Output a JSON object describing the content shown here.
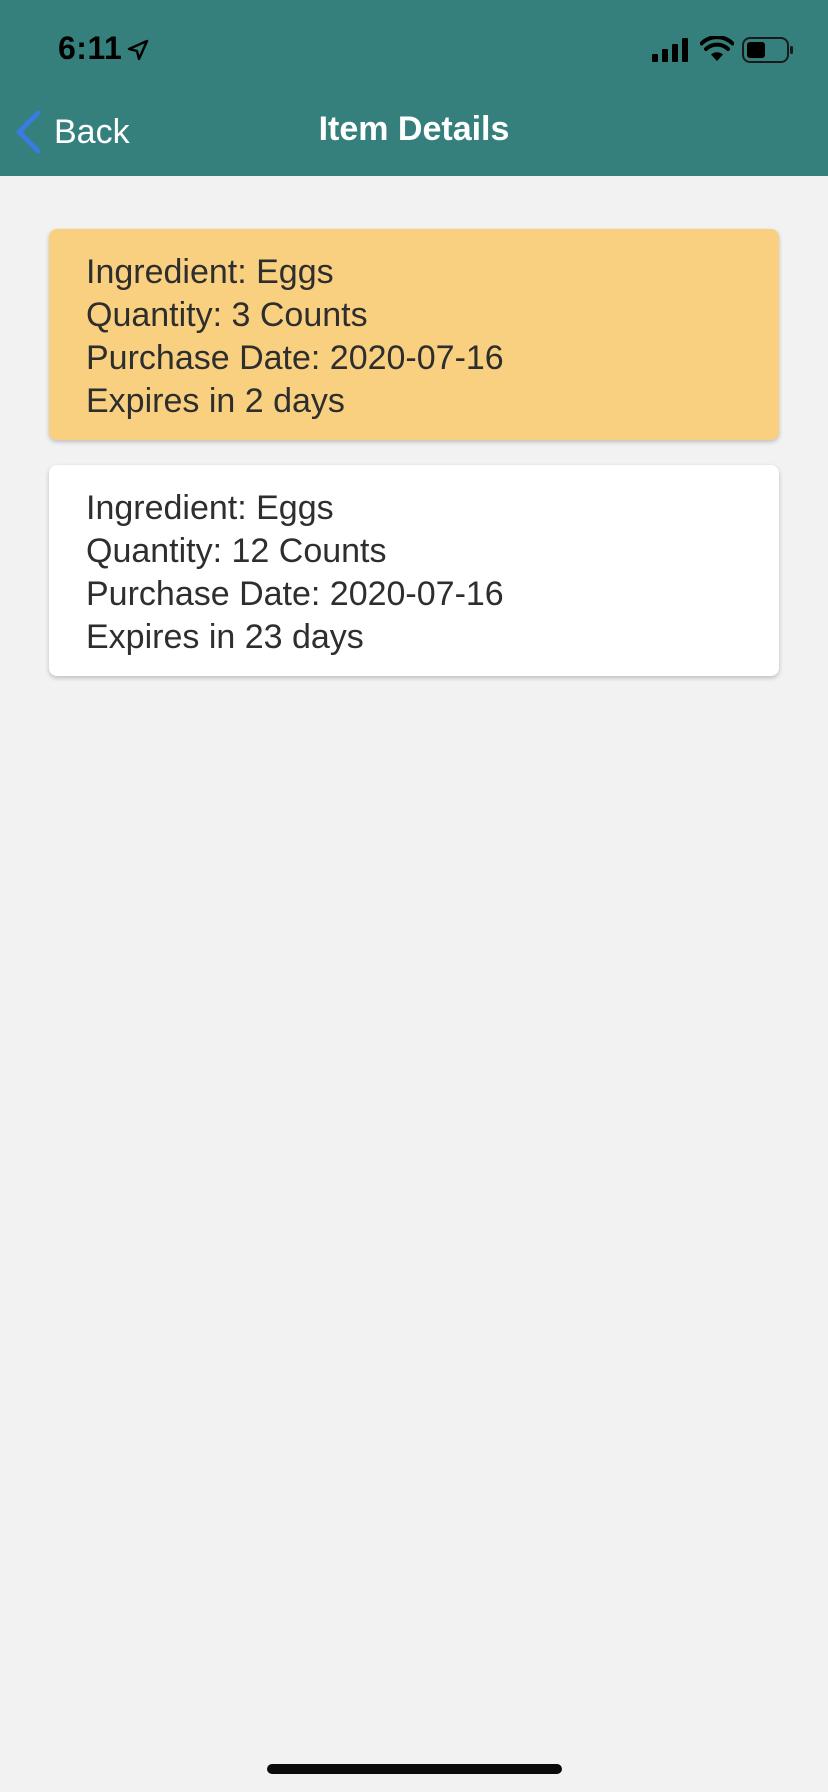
{
  "status_bar": {
    "time": "6:11",
    "location_icon": "location-arrow-icon",
    "signal_icon": "cellular-signal-icon",
    "wifi_icon": "wifi-icon",
    "battery_icon": "battery-icon"
  },
  "nav": {
    "back_label": "Back",
    "title": "Item Details"
  },
  "colors": {
    "header": "#35807c",
    "back_chevron": "#3a7be0",
    "expiring_card": "#f8d080",
    "normal_card": "#ffffff",
    "background": "#f2f2f2"
  },
  "items": [
    {
      "ingredient": "Ingredient: Eggs",
      "quantity": "Quantity: 3 Counts",
      "purchase_date": "Purchase Date: 2020-07-16",
      "expires": "Expires in 2 days"
    },
    {
      "ingredient": "Ingredient: Eggs",
      "quantity": "Quantity: 12 Counts",
      "purchase_date": "Purchase Date: 2020-07-16",
      "expires": "Expires in 23 days"
    }
  ]
}
